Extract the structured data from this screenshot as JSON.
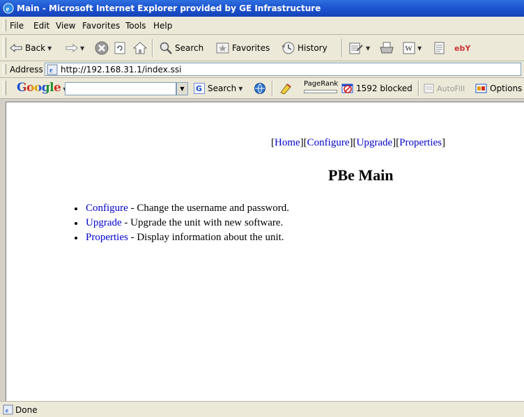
{
  "window": {
    "title": "Main - Microsoft Internet Explorer provided by GE Infrastructure"
  },
  "menu": [
    "File",
    "Edit",
    "View",
    "Favorites",
    "Tools",
    "Help"
  ],
  "toolbar": {
    "back_label": "Back",
    "search_label": "Search",
    "favorites_label": "Favorites",
    "history_label": "History",
    "ebay_label": "ebY"
  },
  "address": {
    "label": "Address",
    "url": "http://192.168.31.1/index.ssi"
  },
  "google": {
    "logo": "Google",
    "search_label": "Search",
    "pagerank_label": "PageRank",
    "blocked_label": "1592 blocked",
    "autofill_label": "AutoFill",
    "options_label": "Options"
  },
  "page": {
    "nav": [
      {
        "label": "Home"
      },
      {
        "label": "Configure"
      },
      {
        "label": "Upgrade"
      },
      {
        "label": "Properties"
      }
    ],
    "heading": "PBe Main",
    "items": [
      {
        "link": "Configure",
        "desc": " - Change the username and password."
      },
      {
        "link": "Upgrade",
        "desc": " - Upgrade the unit with new software."
      },
      {
        "link": "Properties",
        "desc": " - Display information about the unit."
      }
    ]
  },
  "status": {
    "text": "Done"
  },
  "colors": {
    "title_bar": "#1d55d0",
    "link": "#0000cc",
    "chrome": "#ece9d8"
  }
}
